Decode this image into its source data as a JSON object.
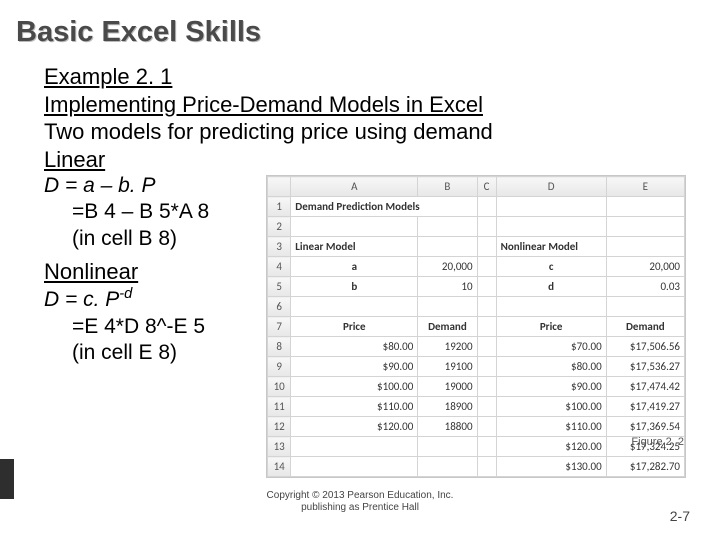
{
  "title": "Basic Excel Skills",
  "example_label": "Example 2. 1",
  "subtitle": "Implementing Price-Demand Models in Excel",
  "intro": "Two models for predicting price using demand",
  "linear": {
    "heading": "Linear",
    "eq": "D = a – b. P",
    "excel_formula": "=B 4 – B 5*A 8",
    "cell_note": "(in cell B 8)"
  },
  "nonlinear": {
    "heading": "Nonlinear",
    "eq_lead": "D = c. P",
    "eq_exp": "-d",
    "excel_formula": "=E 4*D 8^-E 5",
    "cell_note": "(in cell E 8)"
  },
  "figure_caption": "Figure 2. 2",
  "copyright_l1": "Copyright © 2013 Pearson Education, Inc.",
  "copyright_l2": "publishing as Prentice Hall",
  "slide_number": "2-7",
  "excel": {
    "columns": [
      "",
      "A",
      "B",
      "C",
      "D",
      "E"
    ],
    "row_headers": [
      "1",
      "2",
      "3",
      "4",
      "5",
      "6",
      "7",
      "8",
      "9",
      "10",
      "11",
      "12",
      "13",
      "14"
    ],
    "r1": {
      "a": "Demand Prediction Models"
    },
    "r3": {
      "a": "Linear Model",
      "d": "Nonlinear Model"
    },
    "r4": {
      "a": "a",
      "b": "20,000",
      "d": "c",
      "e": "20,000"
    },
    "r5": {
      "a": "b",
      "b": "10",
      "d": "d",
      "e": "0.03"
    },
    "r7": {
      "a": "Price",
      "b": "Demand",
      "d": "Price",
      "e": "Demand"
    },
    "r8": {
      "a": "$80.00",
      "b": "19200",
      "d": "$70.00",
      "e": "$17,506.56"
    },
    "r9": {
      "a": "$90.00",
      "b": "19100",
      "d": "$80.00",
      "e": "$17,536.27"
    },
    "r10": {
      "a": "$100.00",
      "b": "19000",
      "d": "$90.00",
      "e": "$17,474.42"
    },
    "r11": {
      "a": "$110.00",
      "b": "18900",
      "d": "$100.00",
      "e": "$17,419.27"
    },
    "r12": {
      "a": "$120.00",
      "b": "18800",
      "d": "$110.00",
      "e": "$17,369.54"
    },
    "r13": {
      "d": "$120.00",
      "e": "$17,324.25"
    },
    "r14": {
      "d": "$130.00",
      "e": "$17,282.70"
    }
  },
  "chart_data": {
    "type": "table",
    "title": "Demand Prediction Models",
    "series": [
      {
        "name": "Linear Model",
        "params": {
          "a": 20000,
          "b": 10
        },
        "x_label": "Price",
        "y_label": "Demand",
        "x": [
          80.0,
          90.0,
          100.0,
          110.0,
          120.0
        ],
        "y": [
          19200,
          19100,
          19000,
          18900,
          18800
        ]
      },
      {
        "name": "Nonlinear Model",
        "params": {
          "c": 20000,
          "d": 0.03
        },
        "x_label": "Price",
        "y_label": "Demand",
        "x": [
          70.0,
          80.0,
          90.0,
          100.0,
          110.0,
          120.0,
          130.0
        ],
        "y": [
          17506.56,
          17536.27,
          17474.42,
          17419.27,
          17369.54,
          17324.25,
          17282.7
        ]
      }
    ]
  }
}
